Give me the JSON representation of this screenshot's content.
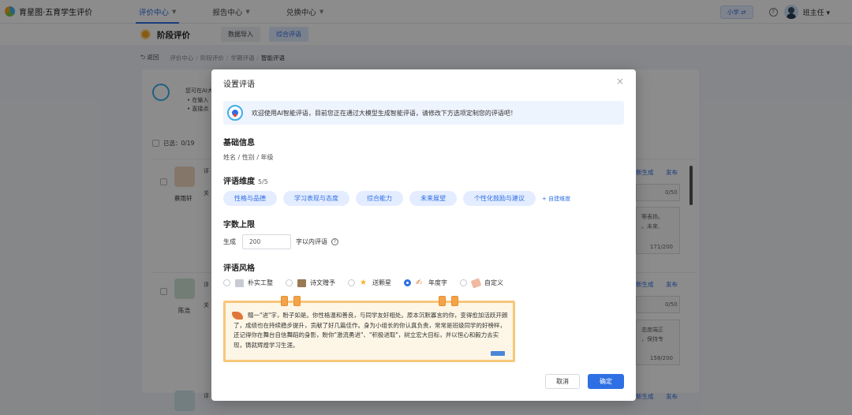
{
  "app": {
    "title": "育星图·五育学生评价"
  },
  "nav": {
    "items": [
      {
        "label": "评价中心",
        "active": true
      },
      {
        "label": "报告中心",
        "active": false
      },
      {
        "label": "兑换中心",
        "active": false
      }
    ]
  },
  "topright": {
    "grade": "小学 ⇄",
    "help": "?",
    "user": "班主任"
  },
  "subbar": {
    "title": "阶段评价",
    "tabs": [
      "数据导入",
      "综合评语"
    ]
  },
  "breadcrumb": {
    "back": "返回",
    "items": [
      "评价中心",
      "阶段评价",
      "学期评语",
      "智能评语"
    ]
  },
  "background": {
    "intro_line1": "您可在AI大",
    "intro_line2": "• 在输入",
    "intro_line3": "• 直接点",
    "selected": "已选：0/19",
    "students": [
      {
        "name": "蔡雨轩",
        "count": "0/50",
        "snippet1": "等表扬。",
        "snippet2": "。未来,",
        "count2": "171/200"
      },
      {
        "name": "陈浩",
        "count": "0/50",
        "snippet1": "态度端正",
        "snippet2": "，保持专",
        "count2": "158/200"
      }
    ],
    "row_label": "评",
    "row_label2": "关",
    "action_regen": "新生成",
    "action_publish": "发布"
  },
  "modal": {
    "title": "设置评语",
    "close": "×",
    "banner": "欢迎使用AI智能评语，目前您正在通过大模型生成智能评语，请修改下方选项定制您的评语吧！",
    "basic_title": "基础信息",
    "basic_fields": "姓名 / 性别 / 年级",
    "dim_title": "评语维度",
    "dim_count": "5/5",
    "dimensions": [
      "性格与品德",
      "学习表现与态度",
      "综合能力",
      "未来展望",
      "个性化鼓励与建议"
    ],
    "add_dim": "+ 自建维度",
    "limit_title": "字数上限",
    "limit_prefix": "生成",
    "limit_value": "200",
    "limit_suffix": "字以内评语",
    "style_title": "评语风格",
    "styles": [
      {
        "label": "朴实工整",
        "icon": "plain-doc-icon",
        "selected": false
      },
      {
        "label": "诗文赠予",
        "icon": "scroll-icon",
        "selected": false
      },
      {
        "label": "送颗星",
        "icon": "star-icon",
        "selected": false
      },
      {
        "label": "年度字",
        "icon": "brush-icon",
        "selected": true
      },
      {
        "label": "自定义",
        "icon": "tag-icon",
        "selected": false
      }
    ],
    "preview": "赠一\"进\"字，盼子如是。你性格温和善良，与同学友好相处。原本沉默寡言的你，变得愈加活跃开朗了，成绩也在持续稳步提升，贡献了好几篇佳作。身为小组长的你认真负责，常常是班级同学的好榜样，还记得你在舞台自信舞蹈的身影，盼你\"激流勇进\"、\"积极进取\"，树立宏大目标，并以恒心和毅力去实现，铸就辉煌学习生涯。",
    "cancel": "取消",
    "ok": "确定"
  },
  "colors": {
    "accent": "#2f6fe4",
    "preview_border": "#f7c77a",
    "preview_bg": "#fdf6e6"
  }
}
